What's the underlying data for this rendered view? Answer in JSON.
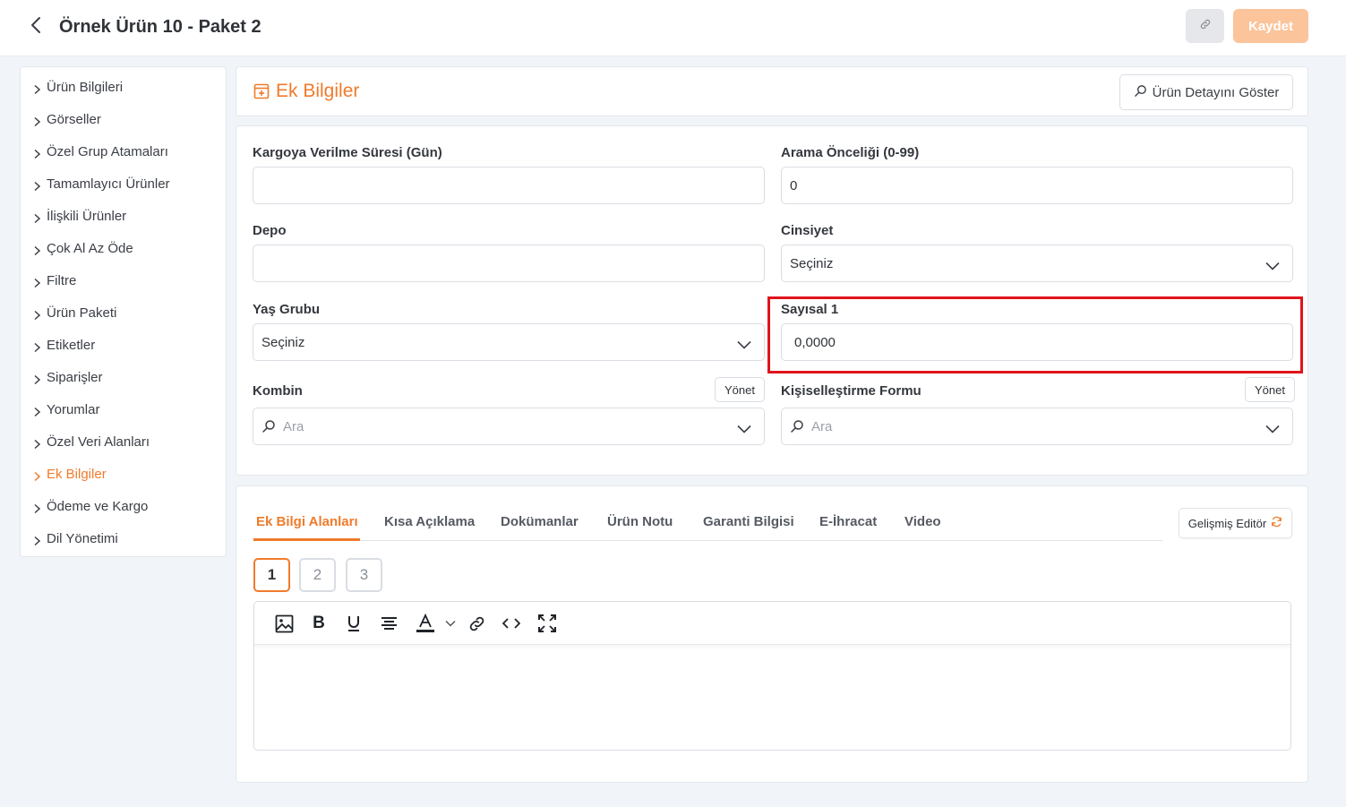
{
  "header": {
    "title": "Örnek Ürün 10 - Paket 2",
    "save_label": "Kaydet"
  },
  "sidebar": {
    "items": [
      {
        "label": "Ürün Bilgileri"
      },
      {
        "label": "Görseller"
      },
      {
        "label": "Özel Grup Atamaları"
      },
      {
        "label": "Tamamlayıcı Ürünler"
      },
      {
        "label": "İlişkili Ürünler"
      },
      {
        "label": "Çok Al Az Öde"
      },
      {
        "label": "Filtre"
      },
      {
        "label": "Ürün Paketi"
      },
      {
        "label": "Etiketler"
      },
      {
        "label": "Siparişler"
      },
      {
        "label": "Yorumlar"
      },
      {
        "label": "Özel Veri Alanları"
      },
      {
        "label": "Ek Bilgiler"
      },
      {
        "label": "Ödeme ve Kargo"
      },
      {
        "label": "Dil Yönetimi"
      }
    ],
    "active": "Ek Bilgiler"
  },
  "section": {
    "title": "Ek Bilgiler",
    "detail_button": "Ürün Detayını Göster"
  },
  "form": {
    "shipping_time": {
      "label": "Kargoya Verilme Süresi (Gün)",
      "value": ""
    },
    "search_priority": {
      "label": "Arama Önceliği (0-99)",
      "value": "0"
    },
    "warehouse": {
      "label": "Depo",
      "value": ""
    },
    "gender": {
      "label": "Cinsiyet",
      "value": "Seçiniz"
    },
    "age_group": {
      "label": "Yaş Grubu",
      "value": "Seçiniz"
    },
    "numeric1": {
      "label": "Sayısal 1",
      "value": "0,0000"
    },
    "combine": {
      "label": "Kombin",
      "placeholder": "Ara",
      "manage_label": "Yönet"
    },
    "personalization": {
      "label": "Kişiselleştirme Formu",
      "placeholder": "Ara",
      "manage_label": "Yönet"
    }
  },
  "editor": {
    "tabs": [
      {
        "label": "Ek Bilgi Alanları"
      },
      {
        "label": "Kısa Açıklama"
      },
      {
        "label": "Dokümanlar"
      },
      {
        "label": "Ürün Notu"
      },
      {
        "label": "Garanti Bilgisi"
      },
      {
        "label": "E-İhracat"
      },
      {
        "label": "Video"
      }
    ],
    "active_tab": "Ek Bilgi Alanları",
    "advanced_label": "Gelişmiş Editör",
    "pages": [
      "1",
      "2",
      "3"
    ],
    "active_page": "1",
    "toolbar_icons": [
      "image-icon",
      "bold-icon",
      "underline-icon",
      "align-icon",
      "text-color-icon",
      "chevron-down-icon",
      "link-icon",
      "code-icon",
      "fullscreen-icon"
    ]
  },
  "colors": {
    "accent": "#f07b2b",
    "save_button": "#fbc49a",
    "highlight": "#e0141c",
    "background": "#f1f4f8"
  }
}
